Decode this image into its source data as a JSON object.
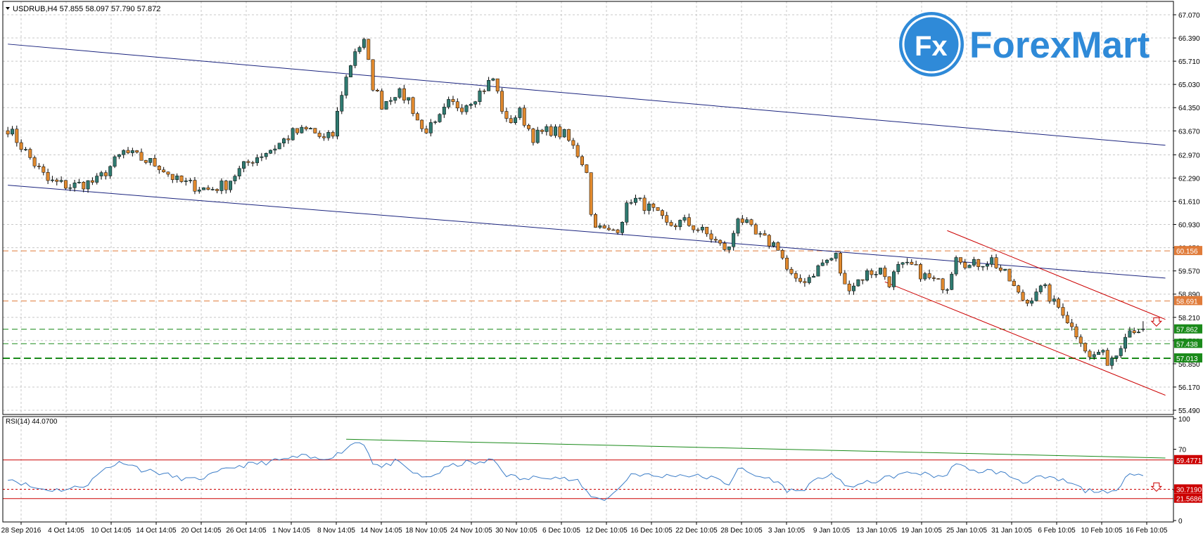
{
  "header": {
    "symbol_line": "USDRUB,H4  57.855 58.097 57.790 57.872",
    "rsi_line": "RSI(14) 44.0700"
  },
  "logo": {
    "badge": "Fx",
    "text": "ForexMart",
    "color": "#2f8ad8"
  },
  "colors": {
    "bull": "#2f7a70",
    "bear": "#e0892e",
    "channel": "#1a237e",
    "red_channel": "#cc0000",
    "grid": "#c8c8c8",
    "rsi_line": "#3d7ec8"
  },
  "chart_data": [
    {
      "type": "candlestick",
      "symbol": "USDRUB",
      "timeframe": "H4",
      "ohlc_last": {
        "open": 57.855,
        "high": 58.097,
        "low": 57.79,
        "close": 57.872
      },
      "ylim": [
        55.49,
        67.07
      ],
      "y_ticks": [
        "67.070",
        "66.390",
        "65.710",
        "65.030",
        "64.350",
        "63.670",
        "62.970",
        "62.290",
        "61.610",
        "60.930",
        "60.250",
        "59.570",
        "58.890",
        "58.210",
        "57.530",
        "56.850",
        "56.170",
        "55.490"
      ],
      "x_ticks": [
        "28 Sep 2016",
        "4 Oct 14:05",
        "10 Oct 14:05",
        "14 Oct 14:05",
        "20 Oct 14:05",
        "26 Oct 14:05",
        "1 Nov 14:05",
        "8 Nov 14:05",
        "14 Nov 14:05",
        "18 Nov 10:05",
        "24 Nov 10:05",
        "30 Nov 10:05",
        "6 Dec 10:05",
        "12 Dec 10:05",
        "16 Dec 10:05",
        "22 Dec 10:05",
        "28 Dec 10:05",
        "3 Jan 10:05",
        "9 Jan 10:05",
        "13 Jan 10:05",
        "19 Jan 10:05",
        "25 Jan 10:05",
        "31 Jan 10:05",
        "6 Feb 10:05",
        "10 Feb 10:05",
        "16 Feb 10:05"
      ],
      "price_levels": [
        {
          "label": "60.156",
          "value": 60.156,
          "color": "#e07b39",
          "style": "dashed"
        },
        {
          "label": "58.691",
          "value": 58.691,
          "color": "#e07b39",
          "style": "dashed"
        },
        {
          "label": "57.862",
          "value": 57.862,
          "color": "#1a8a1a",
          "style": "dashed"
        },
        {
          "label": "57.438",
          "value": 57.438,
          "color": "#1a8a1a",
          "style": "dashed"
        },
        {
          "label": "57.013",
          "value": 57.013,
          "color": "#1a8a1a",
          "style": "dashed-bold"
        }
      ],
      "trendlines": [
        {
          "name": "upper-channel",
          "from": [
            0,
            66.21
          ],
          "to": [
            260,
            63.25
          ]
        },
        {
          "name": "lower-channel",
          "from": [
            0,
            62.08
          ],
          "to": [
            260,
            59.36
          ]
        },
        {
          "name": "red-upper",
          "from": [
            211,
            60.75
          ],
          "to": [
            260,
            58.15
          ]
        },
        {
          "name": "red-lower",
          "from": [
            197,
            59.25
          ],
          "to": [
            260,
            55.93
          ]
        }
      ],
      "anchors": [
        [
          0,
          63.75
        ],
        [
          6,
          62.7
        ],
        [
          9,
          62.2
        ],
        [
          14,
          62.05
        ],
        [
          20,
          62.2
        ],
        [
          26,
          63.05
        ],
        [
          34,
          62.65
        ],
        [
          38,
          62.2
        ],
        [
          45,
          61.95
        ],
        [
          49,
          62.1
        ],
        [
          51,
          62.4
        ],
        [
          55,
          62.85
        ],
        [
          60,
          63.2
        ],
        [
          64,
          63.6
        ],
        [
          68,
          63.7
        ],
        [
          71,
          63.4
        ],
        [
          73,
          63.55
        ],
        [
          75,
          64.8
        ],
        [
          78,
          66.05
        ],
        [
          80,
          66.25
        ],
        [
          82,
          65.0
        ],
        [
          84,
          64.45
        ],
        [
          87,
          64.8
        ],
        [
          90,
          64.6
        ],
        [
          93,
          63.7
        ],
        [
          96,
          63.8
        ],
        [
          99,
          64.45
        ],
        [
          102,
          64.4
        ],
        [
          106,
          64.8
        ],
        [
          109,
          65.2
        ],
        [
          112,
          63.9
        ],
        [
          115,
          64.2
        ],
        [
          118,
          63.5
        ],
        [
          122,
          63.7
        ],
        [
          125,
          63.55
        ],
        [
          128,
          63.0
        ],
        [
          130,
          62.55
        ],
        [
          131,
          61.2
        ],
        [
          133,
          60.8
        ],
        [
          135,
          60.7
        ],
        [
          137,
          60.85
        ],
        [
          140,
          61.7
        ],
        [
          143,
          61.5
        ],
        [
          145,
          61.3
        ],
        [
          148,
          60.9
        ],
        [
          152,
          61.0
        ],
        [
          155,
          60.8
        ],
        [
          158,
          60.55
        ],
        [
          160,
          60.3
        ],
        [
          162,
          60.2
        ],
        [
          164,
          61.2
        ],
        [
          166,
          60.9
        ],
        [
          168,
          60.6
        ],
        [
          171,
          60.4
        ],
        [
          173,
          60.3
        ],
        [
          175,
          59.6
        ],
        [
          177,
          59.2
        ],
        [
          180,
          59.4
        ],
        [
          183,
          59.8
        ],
        [
          186,
          60.0
        ],
        [
          188,
          59.1
        ],
        [
          190,
          59.2
        ],
        [
          193,
          59.5
        ],
        [
          196,
          59.6
        ],
        [
          198,
          59.25
        ],
        [
          200,
          59.65
        ],
        [
          203,
          59.7
        ],
        [
          206,
          59.4
        ],
        [
          209,
          59.2
        ],
        [
          211,
          59.15
        ],
        [
          213,
          60.1
        ],
        [
          216,
          59.7
        ],
        [
          218,
          59.8
        ],
        [
          221,
          59.9
        ],
        [
          223,
          59.6
        ],
        [
          225,
          59.3
        ],
        [
          227,
          58.85
        ],
        [
          229,
          58.65
        ],
        [
          231,
          59.05
        ],
        [
          233,
          59.0
        ],
        [
          235,
          58.6
        ],
        [
          237,
          58.4
        ],
        [
          239,
          57.9
        ],
        [
          241,
          57.6
        ],
        [
          243,
          57.0
        ],
        [
          245,
          57.2
        ],
        [
          247,
          56.95
        ],
        [
          249,
          57.15
        ],
        [
          251,
          57.8
        ],
        [
          253,
          57.9
        ],
        [
          255,
          57.85
        ]
      ]
    },
    {
      "type": "line",
      "name": "RSI(14)",
      "current": 44.07,
      "ylim": [
        0,
        100
      ],
      "y_ticks": [
        "100",
        "70",
        "30",
        "0"
      ],
      "levels": [
        {
          "label": "59.4771",
          "value": 59.4771,
          "color": "#cc0000",
          "style": "solid"
        },
        {
          "label": "30.7190",
          "value": 30.719,
          "color": "#cc0000",
          "style": "dotted"
        },
        {
          "label": "21.5686",
          "value": 21.5686,
          "color": "#cc0000",
          "style": "solid"
        }
      ],
      "trendline": {
        "from": [
          76,
          79.8
        ],
        "to": [
          260,
          61.4
        ],
        "color": "#1a8a1a"
      },
      "anchors": [
        [
          0,
          42
        ],
        [
          6,
          32
        ],
        [
          10,
          30
        ],
        [
          14,
          31
        ],
        [
          18,
          36
        ],
        [
          22,
          52
        ],
        [
          26,
          58
        ],
        [
          30,
          50
        ],
        [
          34,
          47
        ],
        [
          38,
          42
        ],
        [
          42,
          40
        ],
        [
          46,
          45
        ],
        [
          50,
          52
        ],
        [
          54,
          55
        ],
        [
          58,
          57
        ],
        [
          62,
          60
        ],
        [
          66,
          63
        ],
        [
          70,
          60
        ],
        [
          74,
          65
        ],
        [
          78,
          77
        ],
        [
          80,
          76
        ],
        [
          82,
          57
        ],
        [
          84,
          52
        ],
        [
          87,
          58
        ],
        [
          90,
          50
        ],
        [
          93,
          42
        ],
        [
          96,
          45
        ],
        [
          99,
          53
        ],
        [
          103,
          57
        ],
        [
          106,
          56
        ],
        [
          109,
          60
        ],
        [
          112,
          45
        ],
        [
          116,
          40
        ],
        [
          120,
          44
        ],
        [
          124,
          42
        ],
        [
          128,
          38
        ],
        [
          130,
          28
        ],
        [
          132,
          22
        ],
        [
          134,
          21
        ],
        [
          137,
          30
        ],
        [
          140,
          46
        ],
        [
          143,
          45
        ],
        [
          146,
          43
        ],
        [
          150,
          45
        ],
        [
          154,
          44
        ],
        [
          158,
          42
        ],
        [
          162,
          36
        ],
        [
          164,
          52
        ],
        [
          166,
          47
        ],
        [
          168,
          44
        ],
        [
          172,
          40
        ],
        [
          175,
          30
        ],
        [
          178,
          29
        ],
        [
          182,
          40
        ],
        [
          185,
          47
        ],
        [
          188,
          33
        ],
        [
          192,
          36
        ],
        [
          196,
          40
        ],
        [
          200,
          45
        ],
        [
          204,
          47
        ],
        [
          208,
          44
        ],
        [
          211,
          44
        ],
        [
          213,
          58
        ],
        [
          216,
          48
        ],
        [
          220,
          49
        ],
        [
          223,
          47
        ],
        [
          226,
          42
        ],
        [
          228,
          38
        ],
        [
          231,
          42
        ],
        [
          234,
          41
        ],
        [
          237,
          39
        ],
        [
          240,
          34
        ],
        [
          242,
          29
        ],
        [
          244,
          30
        ],
        [
          247,
          26
        ],
        [
          249,
          28
        ],
        [
          251,
          45
        ],
        [
          253,
          47
        ],
        [
          255,
          44
        ]
      ]
    }
  ]
}
